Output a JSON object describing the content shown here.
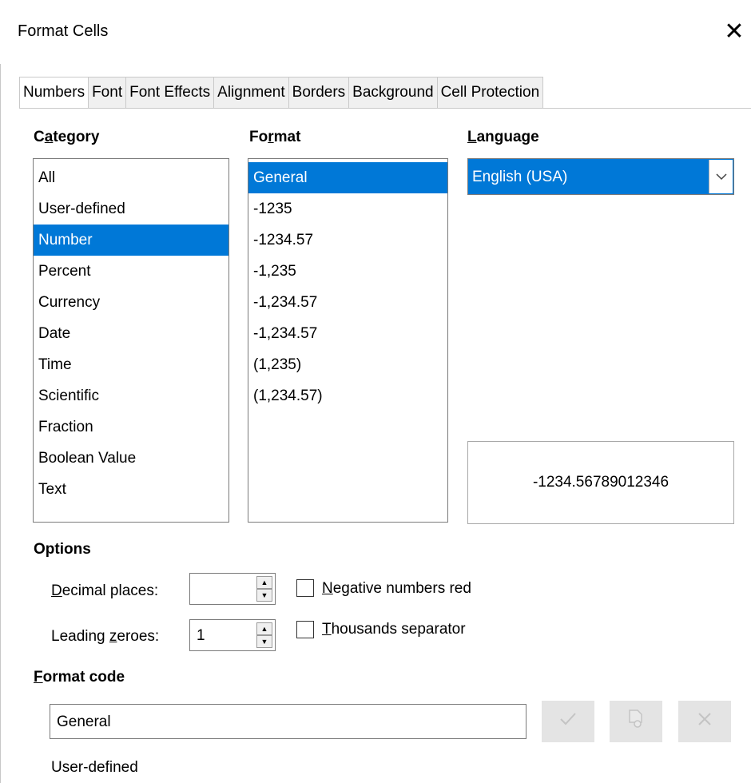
{
  "window": {
    "title": "Format Cells",
    "close_glyph": "✕"
  },
  "tabs": [
    {
      "label": "Numbers",
      "active": true
    },
    {
      "label": "Font",
      "active": false
    },
    {
      "label": "Font Effects",
      "active": false
    },
    {
      "label": "Alignment",
      "active": false
    },
    {
      "label": "Borders",
      "active": false
    },
    {
      "label": "Background",
      "active": false
    },
    {
      "label": "Cell Protection",
      "active": false
    }
  ],
  "category": {
    "header_pre": "C",
    "header_accel": "a",
    "header_post": "tegory",
    "items": [
      "All",
      "User-defined",
      "Number",
      "Percent",
      "Currency",
      "Date",
      "Time",
      "Scientific",
      "Fraction",
      "Boolean Value",
      "Text"
    ],
    "selected": "Number"
  },
  "format": {
    "header_pre": "Fo",
    "header_accel": "r",
    "header_post": "mat",
    "items": [
      "General",
      "-1235",
      "-1234.57",
      "-1,235",
      "-1,234.57",
      "-1,234.57",
      "(1,235)",
      "(1,234.57)"
    ],
    "selected": "General"
  },
  "language": {
    "header_accel": "L",
    "header_post": "anguage",
    "value": "English (USA)",
    "dropdown_icon": "chevron-down-icon"
  },
  "preview": {
    "value": "-1234.56789012346"
  },
  "options": {
    "header": "Options",
    "decimal_places": {
      "label_accel": "D",
      "label_post": "ecimal places:",
      "value": ""
    },
    "leading_zeroes": {
      "label_pre": "Leading ",
      "label_accel": "z",
      "label_post": "eroes:",
      "value": "1"
    },
    "negative_red": {
      "label_accel": "N",
      "label_post": "egative numbers red",
      "checked": false
    },
    "thousands_sep": {
      "label_accel": "T",
      "label_post": "housands separator",
      "checked": false
    }
  },
  "format_code": {
    "header_accel": "F",
    "header_post": "ormat code",
    "value": "General",
    "description": "User-defined",
    "buttons": [
      "check-icon",
      "edit-comment-icon",
      "delete-icon"
    ]
  },
  "colors": {
    "selection": "#0078d7",
    "disabled_button": "#e4e4e4",
    "border": "#7a7a7a"
  }
}
